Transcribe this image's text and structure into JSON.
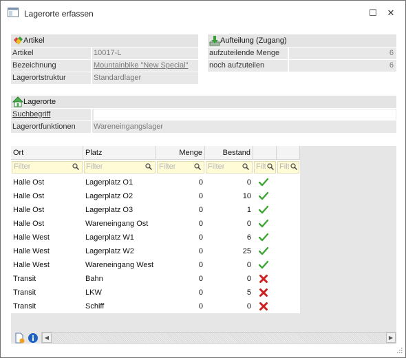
{
  "window": {
    "title": "Lagerorte erfassen",
    "maximize_glyph": "☐",
    "close_glyph": "✕"
  },
  "artikel_panel": {
    "header": "Artikel",
    "icon": "article-gems-icon",
    "rows": [
      {
        "label": "Artikel",
        "value": "10017-L"
      },
      {
        "label": "Bezeichnung",
        "value": "Mountainbike \"New Special\""
      },
      {
        "label": "Lagerortstruktur",
        "value": "Standardlager"
      }
    ]
  },
  "aufteilung_panel": {
    "header": "Aufteilung (Zugang)",
    "icon": "download-tray-icon",
    "rows": [
      {
        "label": "aufzuteilende Menge",
        "value": "6"
      },
      {
        "label": "noch aufzuteilen",
        "value": "6"
      }
    ]
  },
  "lagerorte_panel": {
    "header": "Lagerorte",
    "icon": "warehouse-house-icon",
    "search_label": "Suchbegriff",
    "search_value": "",
    "function_label": "Lagerortfunktionen",
    "function_value": "Wareneingangslager"
  },
  "grid": {
    "columns": [
      "Ort",
      "Platz",
      "Menge",
      "Bestand",
      "",
      ""
    ],
    "filter_placeholders": [
      "Filter",
      "Filter",
      "Filter",
      "Filter",
      "Filt",
      "Filt"
    ],
    "rows": [
      {
        "ort": "Halle Ost",
        "platz": "Lagerplatz O1",
        "menge": "0",
        "bestand": "0",
        "status": "ok"
      },
      {
        "ort": "Halle Ost",
        "platz": "Lagerplatz O2",
        "menge": "0",
        "bestand": "10",
        "status": "ok"
      },
      {
        "ort": "Halle Ost",
        "platz": "Lagerplatz O3",
        "menge": "0",
        "bestand": "1",
        "status": "ok"
      },
      {
        "ort": "Halle Ost",
        "platz": "Wareneingang Ost",
        "menge": "0",
        "bestand": "0",
        "status": "ok"
      },
      {
        "ort": "Halle West",
        "platz": "Lagerplatz W1",
        "menge": "0",
        "bestand": "6",
        "status": "ok"
      },
      {
        "ort": "Halle West",
        "platz": "Lagerplatz W2",
        "menge": "0",
        "bestand": "25",
        "status": "ok"
      },
      {
        "ort": "Halle West",
        "platz": "Wareneingang West",
        "menge": "0",
        "bestand": "0",
        "status": "ok"
      },
      {
        "ort": "Transit",
        "platz": "Bahn",
        "menge": "0",
        "bestand": "0",
        "status": "error"
      },
      {
        "ort": "Transit",
        "platz": "LKW",
        "menge": "0",
        "bestand": "5",
        "status": "error"
      },
      {
        "ort": "Transit",
        "platz": "Schiff",
        "menge": "0",
        "bestand": "0",
        "status": "error"
      }
    ]
  },
  "footer": {
    "left_icon": "new-document-icon",
    "info_icon": "info-icon",
    "scroll_left": "◀",
    "scroll_right": "▶"
  },
  "colors": {
    "ok": "#3fa535",
    "error": "#cc2222",
    "filter_bg": "#fffbd6",
    "panel_bg": "#e8e8e8"
  }
}
